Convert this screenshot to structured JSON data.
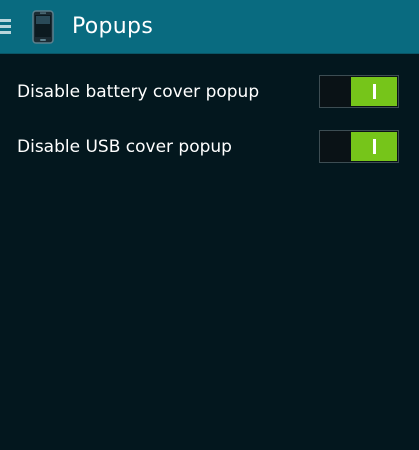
{
  "action_bar": {
    "title": "Popups",
    "nav_icon": "hamburger-menu-icon",
    "app_icon": "phone-cover-icon"
  },
  "settings": [
    {
      "label": "Disable battery cover popup",
      "enabled": true
    },
    {
      "label": "Disable USB cover popup",
      "enabled": true
    }
  ],
  "colors": {
    "action_bar": "#096b80",
    "background": "#03171e",
    "toggle_on": "#76c51a"
  }
}
